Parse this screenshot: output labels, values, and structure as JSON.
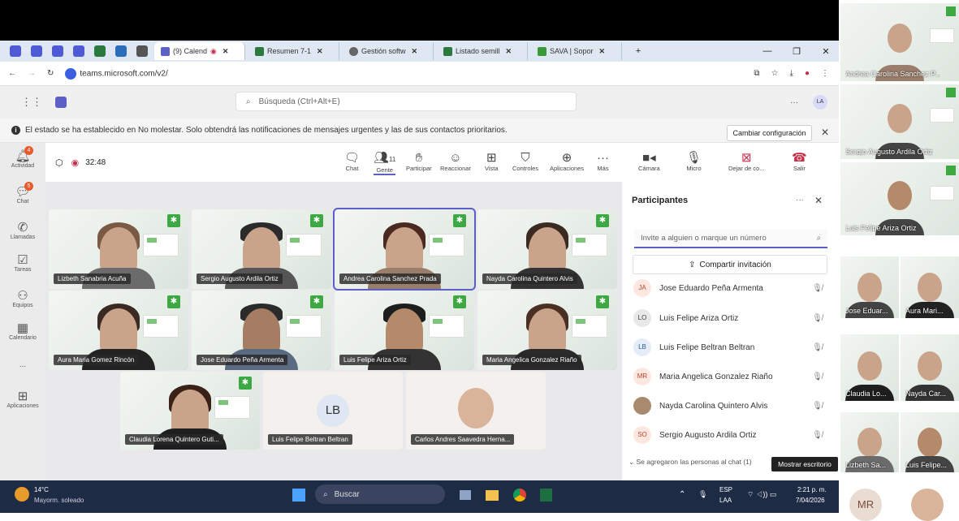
{
  "browser": {
    "tabs": [
      {
        "label": "(9) Calend",
        "active": true
      },
      {
        "label": "Resumen 7-1",
        "active": false
      },
      {
        "label": "Gestión softw",
        "active": false
      },
      {
        "label": "Listado semill",
        "active": false
      },
      {
        "label": "SAVA | Sopor",
        "active": false
      }
    ],
    "new_tab": "+",
    "url": "teams.microsoft.com/v2/"
  },
  "teams": {
    "search_placeholder": "Búsqueda (Ctrl+Alt+E)",
    "user_initials": "LA",
    "notice": "El estado se ha establecido en No molestar. Solo obtendrá las notificaciones de mensajes urgentes y las de sus contactos prioritarios.",
    "change_config": "Cambiar configuración",
    "rail": [
      {
        "label": "Actividad",
        "icon": "bell-icon",
        "badge": "4"
      },
      {
        "label": "Chat",
        "icon": "chat-icon",
        "badge": "5"
      },
      {
        "label": "Llamadas",
        "icon": "phone-icon",
        "badge": ""
      },
      {
        "label": "Tareas",
        "icon": "tasks-icon",
        "badge": ""
      },
      {
        "label": "Equipos",
        "icon": "teams-icon",
        "badge": ""
      },
      {
        "label": "Calendario",
        "icon": "calendar-icon",
        "badge": ""
      },
      {
        "label": "...",
        "icon": "more-icon",
        "badge": ""
      },
      {
        "label": "Aplicaciones",
        "icon": "apps-icon",
        "badge": ""
      }
    ],
    "meeting": {
      "timer": "32:48",
      "people_count": "11",
      "controls": {
        "chat": "Chat",
        "people": "Gente",
        "raise": "Participar",
        "react": "Reaccionar",
        "view": "Vista",
        "controls": "Controles",
        "apps": "Aplicaciones",
        "more": "Más",
        "camera": "Cámara",
        "mic": "Micro",
        "share": "Dejar de co...",
        "leave": "Salir"
      },
      "tiles": [
        {
          "name": "Lizbeth Sanabria Acuña"
        },
        {
          "name": "Sergio Augusto Ardila Ortiz"
        },
        {
          "name": "Andrea Carolina Sanchez Prada"
        },
        {
          "name": "Nayda Carolina Quintero Alvis"
        },
        {
          "name": "Aura Maria Gomez Rincón"
        },
        {
          "name": "Jose Eduardo Peña Armenta"
        },
        {
          "name": "Luis Felipe Ariza Ortiz"
        },
        {
          "name": "Maria Angelica Gonzalez Riaño"
        },
        {
          "name": "Claudia Lorena Quintero Guti..."
        },
        {
          "name": "Luis Felipe Beltran Beltran",
          "initials": "LB"
        },
        {
          "name": "Carlos Andres Saavedra Herna..."
        }
      ]
    },
    "participants": {
      "title": "Participantes",
      "invite_placeholder": "Invite a alguien o marque un número",
      "share_invite": "Compartir invitación",
      "list": [
        {
          "initials": "JA",
          "name": "Jose Eduardo Peña Armenta",
          "color": "#fde7e0"
        },
        {
          "initials": "LO",
          "name": "Luis Felipe Ariza Ortiz",
          "color": "#e8e8e8"
        },
        {
          "initials": "LB",
          "name": "Luis Felipe Beltran Beltran",
          "color": "#e3ecf7"
        },
        {
          "initials": "MR",
          "name": "Maria Angelica Gonzalez Riaño",
          "color": "#fde7e0"
        },
        {
          "initials": "",
          "name": "Nayda Carolina Quintero Alvis",
          "color": "#a98a6e"
        },
        {
          "initials": "SO",
          "name": "Sergio Augusto Ardila Ortiz",
          "color": "#fde7e0"
        }
      ],
      "added_note": "Se agregaron las personas al chat (1)",
      "tooltip": "Mostrar escritorio"
    }
  },
  "taskbar": {
    "temp": "14°C",
    "weather": "Mayorm. soleado",
    "search": "Buscar",
    "lang1": "ESP",
    "lang2": "LAA",
    "time": "2:21 p. m.",
    "date": "7/04/2026"
  },
  "gallery": [
    {
      "label": "Andrea Carolina Sanchez P..."
    },
    {
      "label": "Sergio Augusto Ardila Ortiz"
    },
    {
      "label": "Luis Felipe Ariza Ortiz"
    },
    {
      "label": "Jose Eduar..."
    },
    {
      "label": "Aura Mari..."
    },
    {
      "label": "Claudia Lo..."
    },
    {
      "label": "Nayda Car..."
    },
    {
      "label": "Lizbeth Sa..."
    },
    {
      "label": "Luis Felipe..."
    },
    {
      "label": "MR"
    }
  ]
}
